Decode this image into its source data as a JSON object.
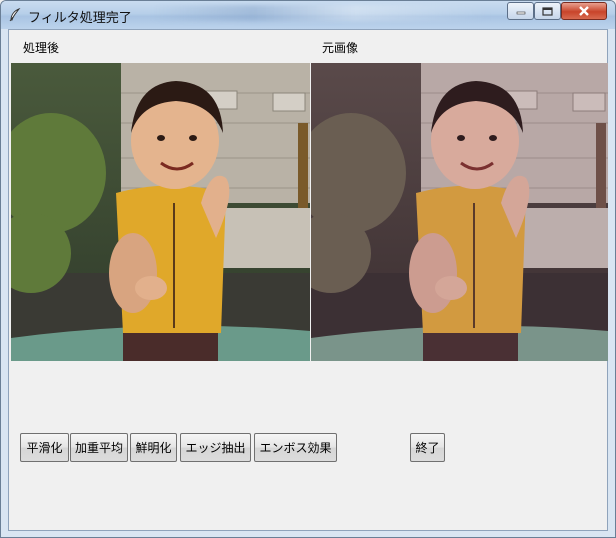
{
  "window": {
    "title": "フィルタ処理完了"
  },
  "labels": {
    "processed": "処理後",
    "original": "元画像"
  },
  "buttons": {
    "smooth": "平滑化",
    "weighted_average": "加重平均",
    "sharpen": "鮮明化",
    "edge_extract": "エッジ抽出",
    "emboss": "エンボス効果",
    "quit": "終了"
  },
  "icons": {
    "app": "feather-icon",
    "minimize": "minimize-icon",
    "maximize": "maximize-icon",
    "close": "close-icon"
  },
  "colors": {
    "close_red": "#c8442a",
    "client_bg": "#f0f0f0"
  }
}
